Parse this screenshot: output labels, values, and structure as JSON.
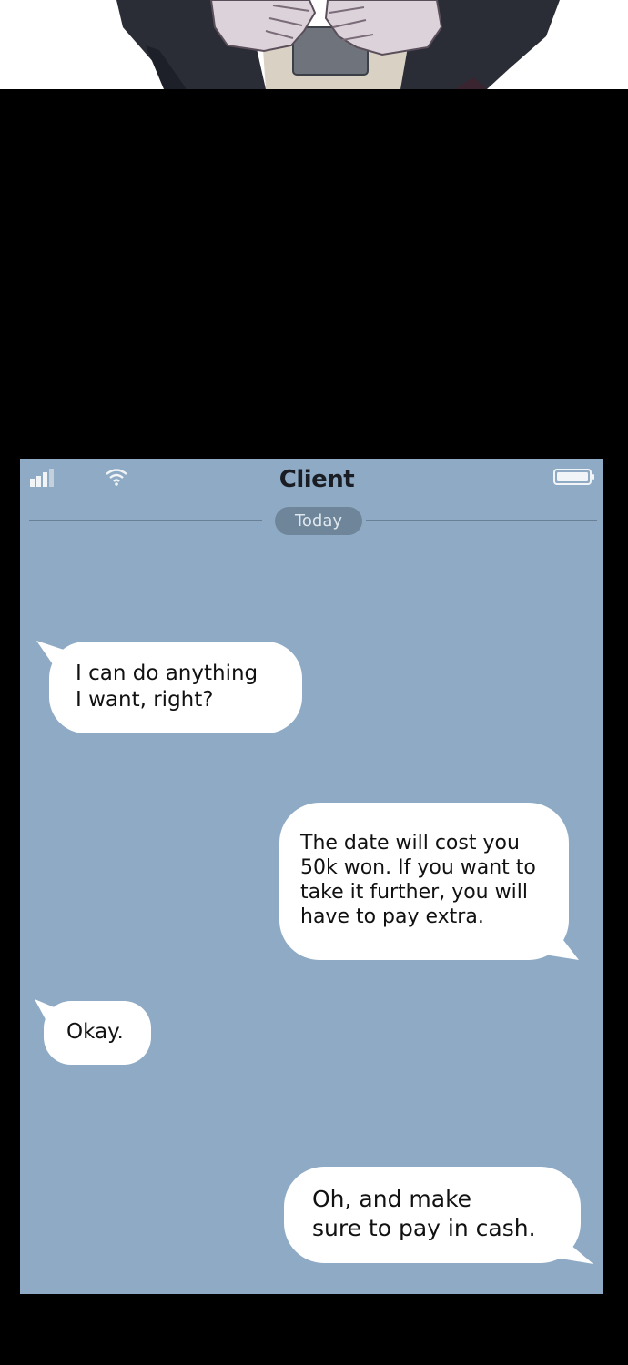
{
  "chat": {
    "title": "Client",
    "date_label": "Today"
  },
  "status_bar": {
    "signal_icon": "signal-bars-icon",
    "wifi_icon": "wifi-icon",
    "battery_icon": "battery-icon"
  },
  "messages": [
    {
      "sender": "incoming",
      "text": "I can do anything\nI want, right?"
    },
    {
      "sender": "outgoing",
      "text": "The date will cost you\n50k won. If you want to\ntake it further, you will\nhave to pay extra."
    },
    {
      "sender": "incoming",
      "text": "Okay."
    },
    {
      "sender": "outgoing",
      "text": "Oh, and make\nsure to pay in cash."
    }
  ],
  "colors": {
    "screen_background": "#8eaac4",
    "bubble": "#ffffff",
    "page_background": "#000000",
    "date_pill": "#6f8599"
  }
}
